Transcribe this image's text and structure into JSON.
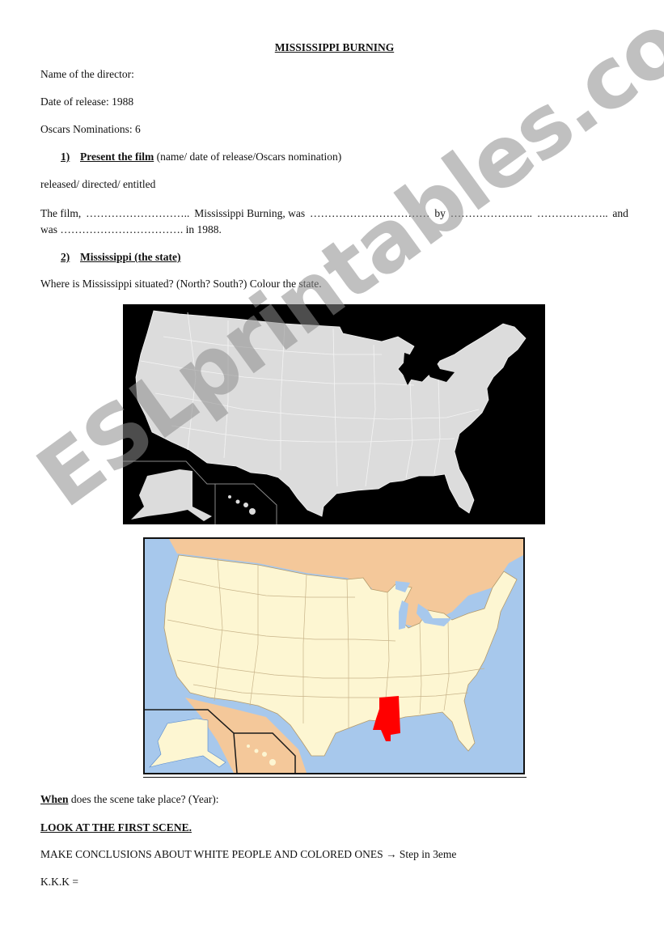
{
  "document": {
    "title": "MISSISSIPPI BURNING",
    "fields": {
      "director": "Name of the director:",
      "release_date": "Date of release: 1988",
      "oscars": "Oscars Nominations: 6"
    },
    "section1": {
      "number": "1)",
      "heading": "Present the film",
      "hint": " (name/ date of release/Oscars nomination)",
      "word_bank": "released/ directed/ entitled",
      "gap_text": {
        "p1": "The film,",
        "b1": "………………………..",
        "p2": "Mississippi Burning, was",
        "b2": "……………………………",
        "p3": "by",
        "b3": "…………………..",
        "b4": "………………..",
        "p4": "and",
        "p5": "was",
        "b5": "…………………………….",
        "p6": "in 1988."
      }
    },
    "section2": {
      "number": "2)",
      "heading": "Mississippi (the state)",
      "question": "Where is Mississippi situated? (North? South?) Colour the state.",
      "map1_description": "Blank map of the United States (grey states on black)",
      "map2_description": "Map of the United States with Mississippi highlighted in red",
      "highlighted_state": "Mississippi",
      "highlight_color": "#ff0000"
    },
    "when": {
      "bold": "When",
      "rest": " does the scene take place? (Year):"
    },
    "look": "LOOK AT THE FIRST SCENE.",
    "conclusions": {
      "text": "MAKE CONCLUSIONS ABOUT WHITE PEOPLE AND COLORED ONES ",
      "arrow": "→",
      "step": " Step in 3eme"
    },
    "kkk": "K.K.K ="
  },
  "watermark": "ESLprintables.com",
  "colors": {
    "map1_land": "#dcdcdc",
    "map1_bg": "#000000",
    "map2_land": "#fdf6d2",
    "map2_water": "#a7c8ec",
    "map2_foreign": "#f4c89a"
  }
}
